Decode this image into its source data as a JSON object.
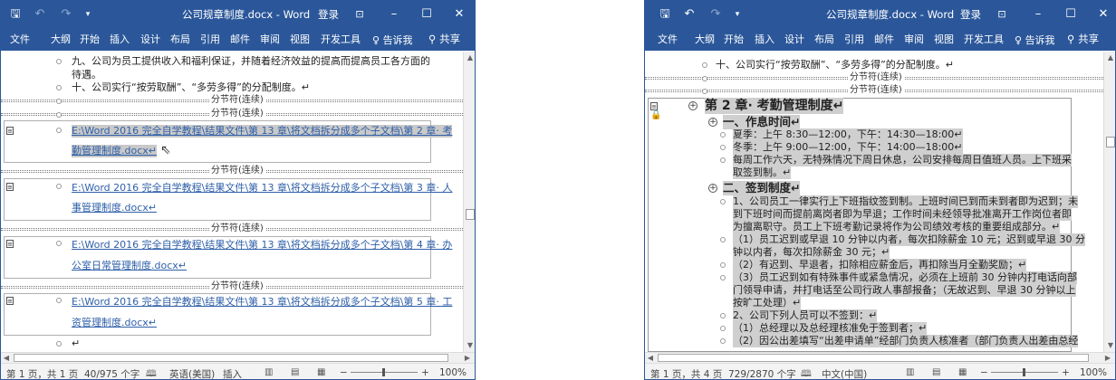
{
  "colors": {
    "accent": "#2b579a",
    "selection": "#cfcfcf",
    "link": "#2e5fa8"
  },
  "left": {
    "title": "公司规章制度.docx - Word",
    "login": "登录",
    "tabs": [
      "文件",
      "大纲",
      "开始",
      "插入",
      "设计",
      "布局",
      "引用",
      "邮件",
      "审阅",
      "视图",
      "开发工具"
    ],
    "tell_me": "告诉我",
    "share": "共享",
    "lines": [
      "九、公司为员工提供收入和福利保证，并随着经济效益的提高而提高员工各方面的",
      "待遇。",
      "十、公司实行“按劳取酬”、“多劳多得”的分配制度。↵"
    ],
    "section_break": "分节符(连续)",
    "subdocs": [
      {
        "line1": "E:\\Word 2016 完全自学教程\\结果文件\\第 13 章\\将文档拆分成多个子文档\\第 2 章· 考",
        "line2": "勤管理制度.docx↵"
      },
      {
        "line1": "E:\\Word 2016 完全自学教程\\结果文件\\第 13 章\\将文档拆分成多个子文档\\第 3 章· 人",
        "line2": "事管理制度.docx↵"
      },
      {
        "line1": "E:\\Word 2016 完全自学教程\\结果文件\\第 13 章\\将文档拆分成多个子文档\\第 4 章· 办",
        "line2": "公室日常管理制度.docx↵"
      },
      {
        "line1": "E:\\Word 2016 完全自学教程\\结果文件\\第 13 章\\将文档拆分成多个子文档\\第 5 章· 工",
        "line2": "资管理制度.docx↵"
      }
    ],
    "last_para": "↵",
    "status": {
      "page": "第 1 页，共 1 页",
      "words": "40/975 个字",
      "lang": "英语(美国)",
      "mode": "插入",
      "zoom": "100%"
    }
  },
  "right": {
    "title": "公司规章制度.docx - Word",
    "login": "登录",
    "tabs": [
      "文件",
      "大纲",
      "开始",
      "插入",
      "设计",
      "布局",
      "引用",
      "邮件",
      "审阅",
      "视图",
      "开发工具"
    ],
    "tell_me": "告诉我",
    "share": "共享",
    "top_line": "十、公司实行“按劳取酬”、“多劳多得”的分配制度。↵",
    "section_break": "分节符(连续)",
    "chapter": "第 2 章· 考勤管理制度↵",
    "h_worktime": "一、作息时间↵",
    "worktime_lines": [
      "夏季：上午 8:30—12:00，下午：14:30—18:00↵",
      "冬季：上午 9:00—12:00，下午：14:00—18:00↵",
      "每周工作六天，无特殊情况下周日休息，公司安排每周日值班人员。上下班采",
      "取签到制。↵"
    ],
    "h_signin": "二、签到制度↵",
    "signin_lines": [
      "1、公司员工一律实行上下班指纹签到制。上班时间已到而未到者即为迟到；未",
      "到下班时间而提前离岗者即为早退；工作时间未经领导批准离开工作岗位者即",
      "为擅离职守。员工上下班考勤记录将作为公司绩效考核的重要组成部分。↵",
      "（1）员工迟到或早退 10 分钟以内者，每次扣除薪金 10 元；迟到或早退 30 分",
      "钟以内者，每次扣除薪金 30 元；↵",
      "（2）有迟到、早退者，扣除相应薪金后，再扣除当月全勤奖励；↵",
      "（3）员工迟到如有特殊事件或紧急情况，必须在上班前 30 分钟内打电话向部",
      "门领导申请，并打电话至公司行政人事部报备；（无故迟到、早退 30 分钟以上",
      "按旷工处理）↵",
      "2、公司下列人员可以不签到：↵",
      "（1）总经理以及总经理核准免于签到者；↵",
      "（2）因公出差填写“出差申请单”经部门负责人核准者（部门负责人出差由总经"
    ],
    "status": {
      "page": "第 1 页，共 4 页",
      "words": "729/2870 个字",
      "lang": "中文(中国)",
      "zoom": "100%"
    }
  }
}
